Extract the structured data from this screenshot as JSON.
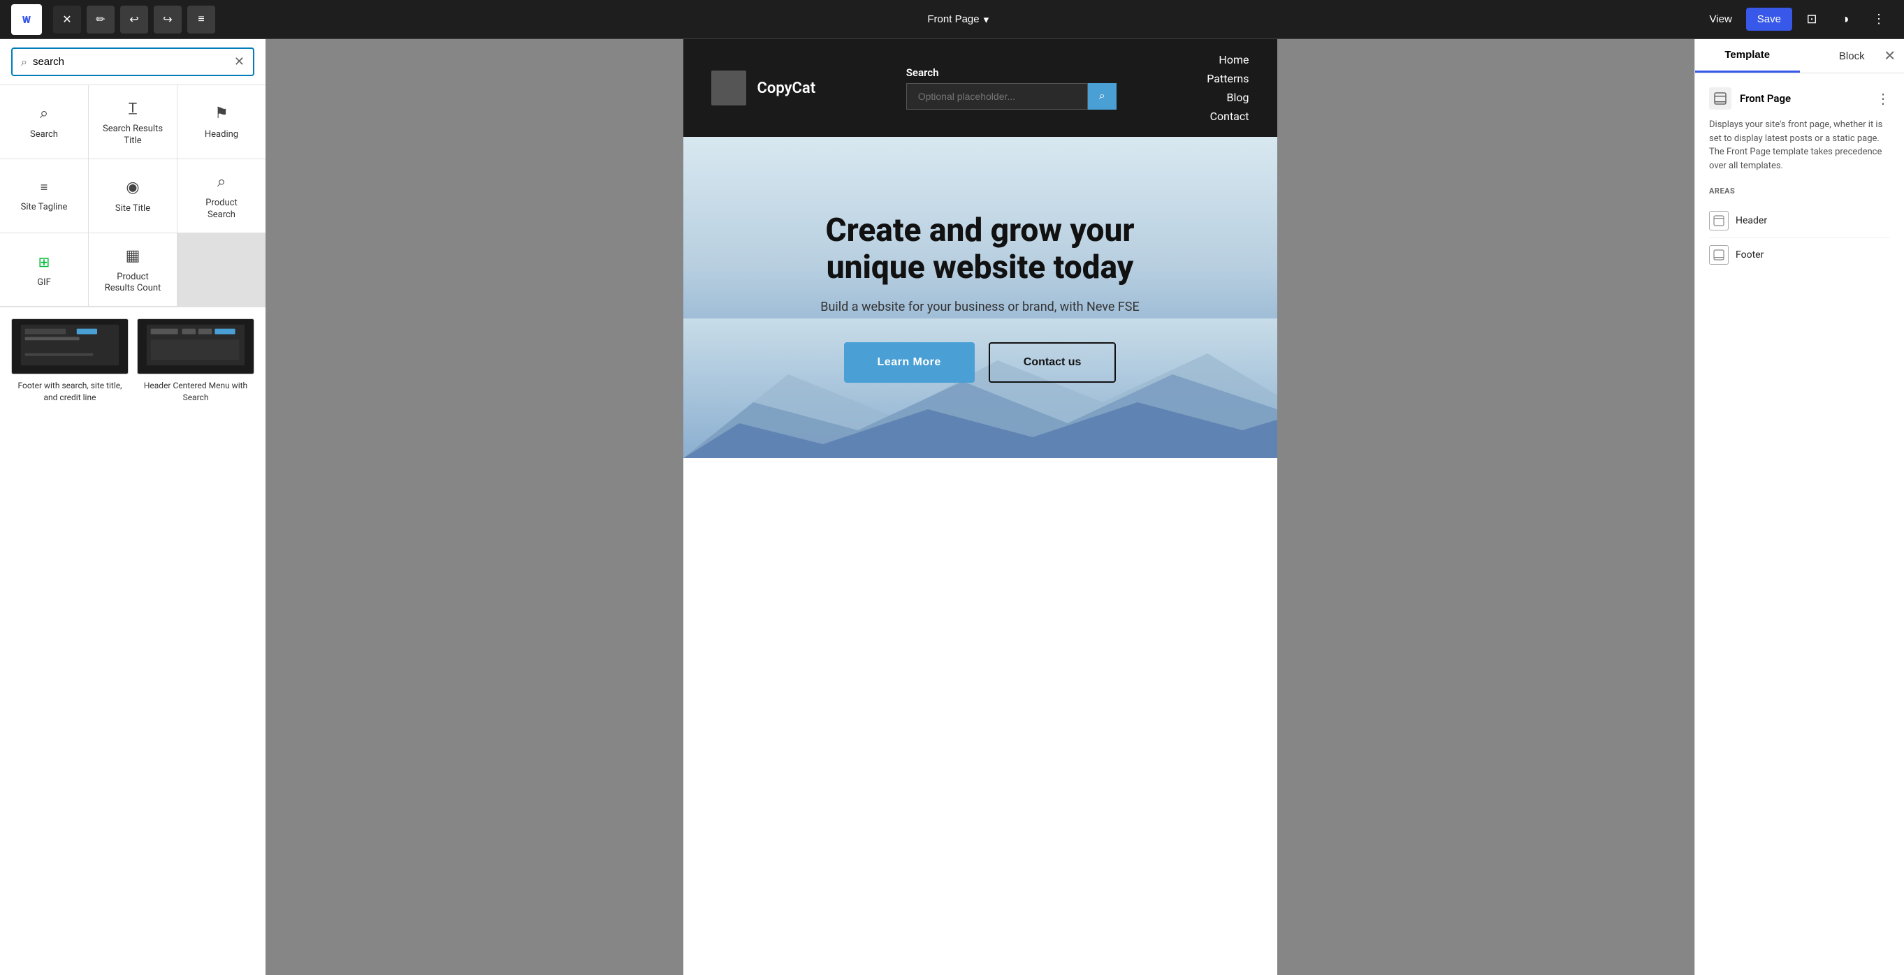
{
  "toolbar": {
    "wp_logo": "W",
    "close_label": "✕",
    "pencil_label": "✏",
    "undo_label": "↩",
    "redo_label": "↪",
    "list_view_label": "≡",
    "page_title": "Front Page",
    "chevron": "▾",
    "view_label": "View",
    "save_label": "Save",
    "layout_icon": "⊡",
    "contrast_icon": "◑",
    "more_icon": "⋮"
  },
  "left_sidebar": {
    "search_placeholder": "search",
    "search_value": "search",
    "clear_icon": "✕",
    "blocks": [
      {
        "id": "search",
        "icon": "⌕",
        "label": "Search",
        "icon_color": ""
      },
      {
        "id": "search-results-title",
        "icon": "T̲",
        "label": "Search Results\nTitle",
        "icon_color": ""
      },
      {
        "id": "heading",
        "icon": "⚑",
        "label": "Heading",
        "icon_color": ""
      },
      {
        "id": "site-tagline",
        "icon": "≡",
        "label": "Site Tagline",
        "icon_color": ""
      },
      {
        "id": "site-title",
        "icon": "◉",
        "label": "Site Title",
        "icon_color": ""
      },
      {
        "id": "product-search",
        "icon": "⌕",
        "label": "Product\nSearch",
        "icon_color": ""
      },
      {
        "id": "gif",
        "icon": "⊞",
        "label": "GIF",
        "icon_color": "green"
      },
      {
        "id": "product-results-count",
        "icon": "▦",
        "label": "Product\nResults Count",
        "icon_color": ""
      }
    ],
    "patterns": [
      {
        "id": "footer-pattern",
        "label": "Footer with search, site title, and credit line"
      },
      {
        "id": "header-pattern",
        "label": "Header Centered Menu with Search"
      }
    ]
  },
  "canvas": {
    "header": {
      "logo_alt": "Logo placeholder",
      "site_name": "CopyCat",
      "search_label": "Search",
      "search_placeholder": "Optional placeholder...",
      "search_btn_icon": "⌕",
      "nav_items": [
        "Home",
        "Patterns",
        "Blog",
        "Contact"
      ]
    },
    "hero": {
      "title": "Create and grow your\nunique website today",
      "subtitle": "Build a website for your business or brand, with Neve FSE",
      "btn_primary": "Learn More",
      "btn_secondary": "Contact us"
    }
  },
  "right_panel": {
    "tabs": [
      {
        "id": "template",
        "label": "Template",
        "active": true
      },
      {
        "id": "block",
        "label": "Block",
        "active": false
      }
    ],
    "close_icon": "✕",
    "item": {
      "icon": "⊡",
      "title": "Front Page",
      "menu_icon": "⋮",
      "description": "Displays your site's front page, whether it is set to display latest posts or a static page. The Front Page template takes precedence over all templates."
    },
    "areas_label": "AREAS",
    "areas": [
      {
        "id": "header",
        "icon": "⊡",
        "label": "Header"
      },
      {
        "id": "footer",
        "icon": "⊡",
        "label": "Footer"
      }
    ]
  },
  "colors": {
    "accent_blue": "#3858e9",
    "btn_blue": "#4a9fd5",
    "dark_bg": "#1a1a1a",
    "green": "#00ba37"
  }
}
